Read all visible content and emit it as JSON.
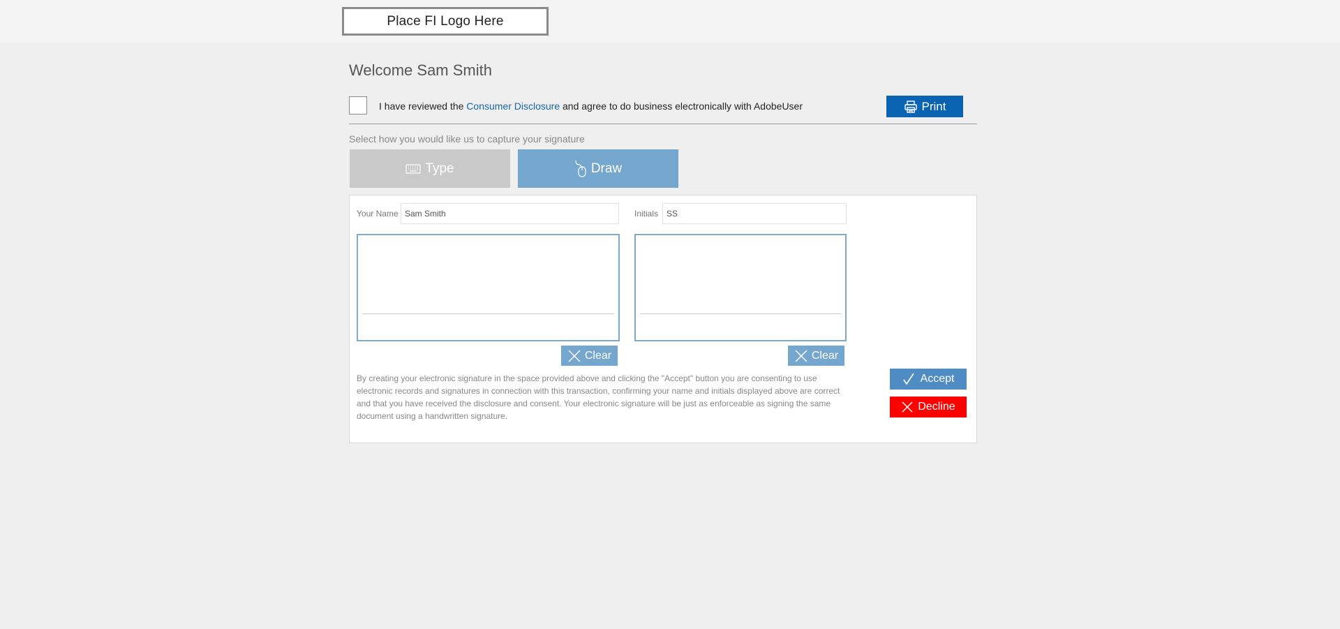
{
  "header": {
    "logo_placeholder": "Place FI Logo Here"
  },
  "welcome": {
    "title": "Welcome Sam Smith"
  },
  "consent": {
    "text_before": "I have reviewed the ",
    "link_label": "Consumer Disclosure",
    "text_after": " and agree to do business electronically with AdobeUser",
    "checked": false
  },
  "print_button": {
    "label": "Print",
    "icon": "printer-icon"
  },
  "capture": {
    "prompt": "Select how you would like us to capture your signature",
    "modes": [
      {
        "label": "Type",
        "icon": "keyboard-icon",
        "selected": false
      },
      {
        "label": "Draw",
        "icon": "mouse-icon",
        "selected": true
      }
    ]
  },
  "form": {
    "name_label": "Your Name",
    "name_value": "Sam Smith",
    "initials_label": "Initials",
    "initials_value": "SS",
    "clear_label": "Clear",
    "clear_icon": "close-icon"
  },
  "legal_text": "By creating your electronic signature in the space provided above and clicking the \"Accept\" button you are consenting to use electronic records and signatures in connection with this transaction, confirming your name and initials displayed above are correct and that you have received the disclosure and consent. Your electronic signature will be just as enforceable as signing the same document using a handwritten signature.",
  "actions": {
    "accept_label": "Accept",
    "accept_icon": "checkmark-icon",
    "decline_label": "Decline",
    "decline_icon": "close-icon"
  },
  "colors": {
    "print_blue": "#0a63b0",
    "draw_blue": "#75a6ce",
    "accept_blue": "#4f8cc4",
    "decline_red": "#ff0000",
    "link_blue": "#1466a8",
    "type_gray": "#c9c9c9"
  }
}
